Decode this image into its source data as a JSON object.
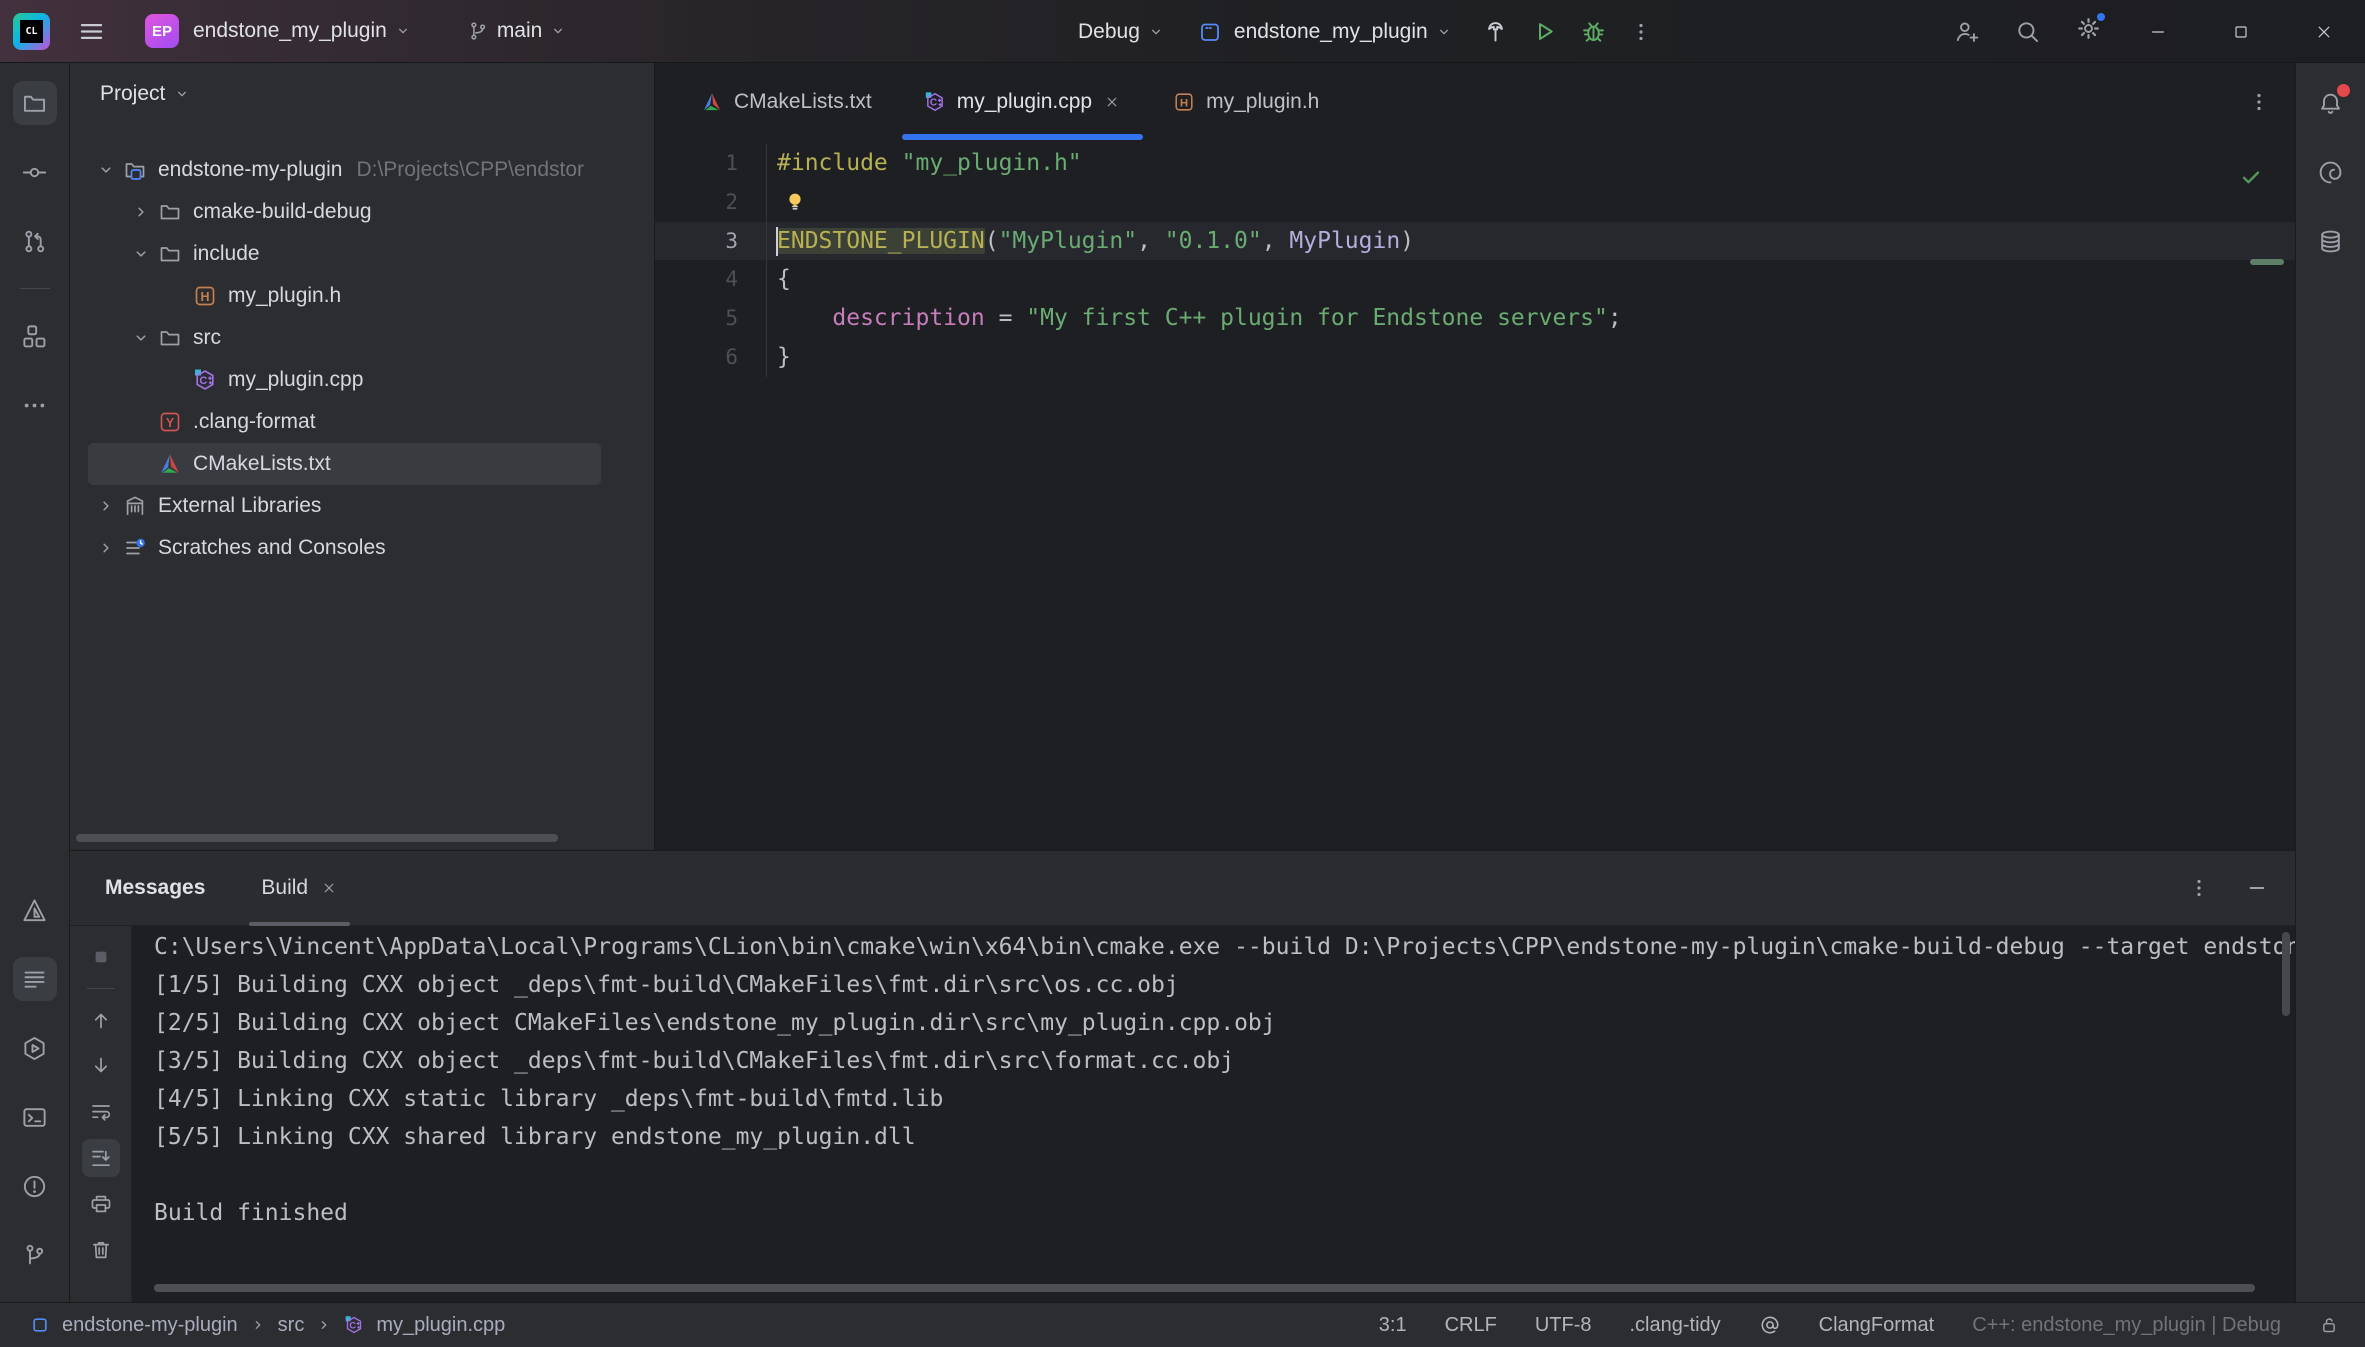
{
  "titlebar": {
    "app_name": "CL",
    "project_initials": "EP",
    "project_name": "endstone_my_plugin",
    "branch_name": "main",
    "run_mode": "Debug",
    "run_target": "endstone_my_plugin",
    "icons": [
      "hamburger",
      "git-branch",
      "chevron-down",
      "run-config-app",
      "build-hammer",
      "run-play",
      "debug-bug",
      "kebab-menu",
      "add-user",
      "search",
      "settings-gear",
      "window-minimize",
      "window-maximize",
      "window-close"
    ]
  },
  "left_stripe": {
    "top": [
      {
        "icon": "folder",
        "name": "project",
        "active": true
      },
      {
        "icon": "commit",
        "name": "commit"
      },
      {
        "icon": "pull-request",
        "name": "pull-requests"
      },
      {
        "divider": true
      },
      {
        "icon": "structure",
        "name": "structure"
      },
      {
        "icon": "more",
        "name": "more-tool-windows"
      }
    ],
    "bottom": [
      {
        "icon": "cmake-mono",
        "name": "cmake"
      },
      {
        "icon": "messages",
        "name": "messages",
        "active": true
      },
      {
        "icon": "run-hex",
        "name": "run"
      },
      {
        "icon": "terminal",
        "name": "terminal"
      },
      {
        "icon": "problems",
        "name": "problems"
      },
      {
        "icon": "git",
        "name": "version-control"
      }
    ]
  },
  "right_stripe": [
    {
      "icon": "bell",
      "name": "notifications",
      "badge": true
    },
    {
      "icon": "ai",
      "name": "ai-assistant"
    },
    {
      "icon": "database",
      "name": "database"
    }
  ],
  "project_panel": {
    "title": "Project",
    "tree": [
      {
        "label": "endstone-my-plugin",
        "hint": "D:\\Projects\\CPP\\endstor",
        "icon": "folder-project",
        "level": 0,
        "chevron": "down"
      },
      {
        "label": "cmake-build-debug",
        "icon": "folder",
        "level": 1,
        "chevron": "right"
      },
      {
        "label": "include",
        "icon": "folder",
        "level": 1,
        "chevron": "down"
      },
      {
        "label": "my_plugin.h",
        "icon": "h-file",
        "level": 2
      },
      {
        "label": "src",
        "icon": "folder",
        "level": 1,
        "chevron": "down"
      },
      {
        "label": "my_plugin.cpp",
        "icon": "cpp-file",
        "level": 2
      },
      {
        "label": ".clang-format",
        "icon": "yaml-file",
        "level": 1
      },
      {
        "label": "CMakeLists.txt",
        "icon": "cmake",
        "level": 1,
        "selected": true
      },
      {
        "label": "External Libraries",
        "icon": "library",
        "level": 0,
        "chevron": "right"
      },
      {
        "label": "Scratches and Consoles",
        "icon": "scratches",
        "level": 0,
        "chevron": "right"
      }
    ]
  },
  "editor": {
    "tabs": [
      {
        "label": "CMakeLists.txt",
        "icon": "cmake"
      },
      {
        "label": "my_plugin.cpp",
        "icon": "cpp-file",
        "active": true,
        "close": true
      },
      {
        "label": "my_plugin.h",
        "icon": "h-file"
      }
    ],
    "lines": [
      {
        "n": "1",
        "tokens": [
          [
            "macro",
            "#include"
          ],
          [
            "plain",
            " "
          ],
          [
            "string",
            "\"my_plugin.h\""
          ]
        ]
      },
      {
        "n": "2",
        "bulb": true,
        "tokens": []
      },
      {
        "n": "3",
        "current": true,
        "caret": true,
        "tokens": [
          [
            "macro hl",
            "ENDSTONE_PLUGIN"
          ],
          [
            "plain",
            "("
          ],
          [
            "string",
            "\"MyPlugin\""
          ],
          [
            "plain",
            ", "
          ],
          [
            "string",
            "\"0.1.0\""
          ],
          [
            "plain",
            ", "
          ],
          [
            "class",
            "MyPlugin"
          ],
          [
            "plain",
            ")"
          ]
        ]
      },
      {
        "n": "4",
        "tokens": [
          [
            "plain",
            "{"
          ]
        ]
      },
      {
        "n": "5",
        "tokens": [
          [
            "plain",
            "    "
          ],
          [
            "field",
            "description"
          ],
          [
            "plain",
            " = "
          ],
          [
            "string",
            "\"My first C++ plugin for Endstone servers\""
          ],
          [
            "plain",
            ";"
          ]
        ]
      },
      {
        "n": "6",
        "tokens": [
          [
            "plain",
            "}"
          ]
        ]
      }
    ]
  },
  "build_panel": {
    "title": "Messages",
    "tab": "Build",
    "toolbar": [
      {
        "icon": "stop",
        "name": "stop"
      },
      {
        "divider": true
      },
      {
        "icon": "arrow-up",
        "name": "previous-message"
      },
      {
        "icon": "arrow-down",
        "name": "next-message"
      },
      {
        "icon": "soft-wrap",
        "name": "soft-wrap"
      },
      {
        "icon": "scroll-end",
        "name": "scroll-to-end",
        "active": true
      },
      {
        "icon": "printer",
        "name": "print"
      },
      {
        "icon": "trash",
        "name": "clear-all"
      }
    ],
    "lines": [
      "C:\\Users\\Vincent\\AppData\\Local\\Programs\\CLion\\bin\\cmake\\win\\x64\\bin\\cmake.exe --build D:\\Projects\\CPP\\endstone-my-plugin\\cmake-build-debug --target endstone_my_plugin",
      "[1/5] Building CXX object _deps\\fmt-build\\CMakeFiles\\fmt.dir\\src\\os.cc.obj",
      "[2/5] Building CXX object CMakeFiles\\endstone_my_plugin.dir\\src\\my_plugin.cpp.obj",
      "[3/5] Building CXX object _deps\\fmt-build\\CMakeFiles\\fmt.dir\\src\\format.cc.obj",
      "[4/5] Linking CXX static library _deps\\fmt-build\\fmtd.lib",
      "[5/5] Linking CXX shared library endstone_my_plugin.dll",
      "",
      "Build finished"
    ]
  },
  "statusbar": {
    "crumbs": [
      "endstone-my-plugin",
      "src",
      "my_plugin.cpp"
    ],
    "caret_position": "3:1",
    "line_separator": "CRLF",
    "encoding": "UTF-8",
    "clang_tidy": ".clang-tidy",
    "clang_format": "ClangFormat",
    "toolchain": "C++: endstone_my_plugin | Debug"
  },
  "colors": {
    "accent": "#3574f0",
    "string_token": "#6aab73",
    "macro_token": "#b8b153",
    "field_token": "#c77dbb",
    "class_token": "#b3aedb",
    "notification_badge": "#e5484d",
    "run_green": "#5fad65"
  }
}
